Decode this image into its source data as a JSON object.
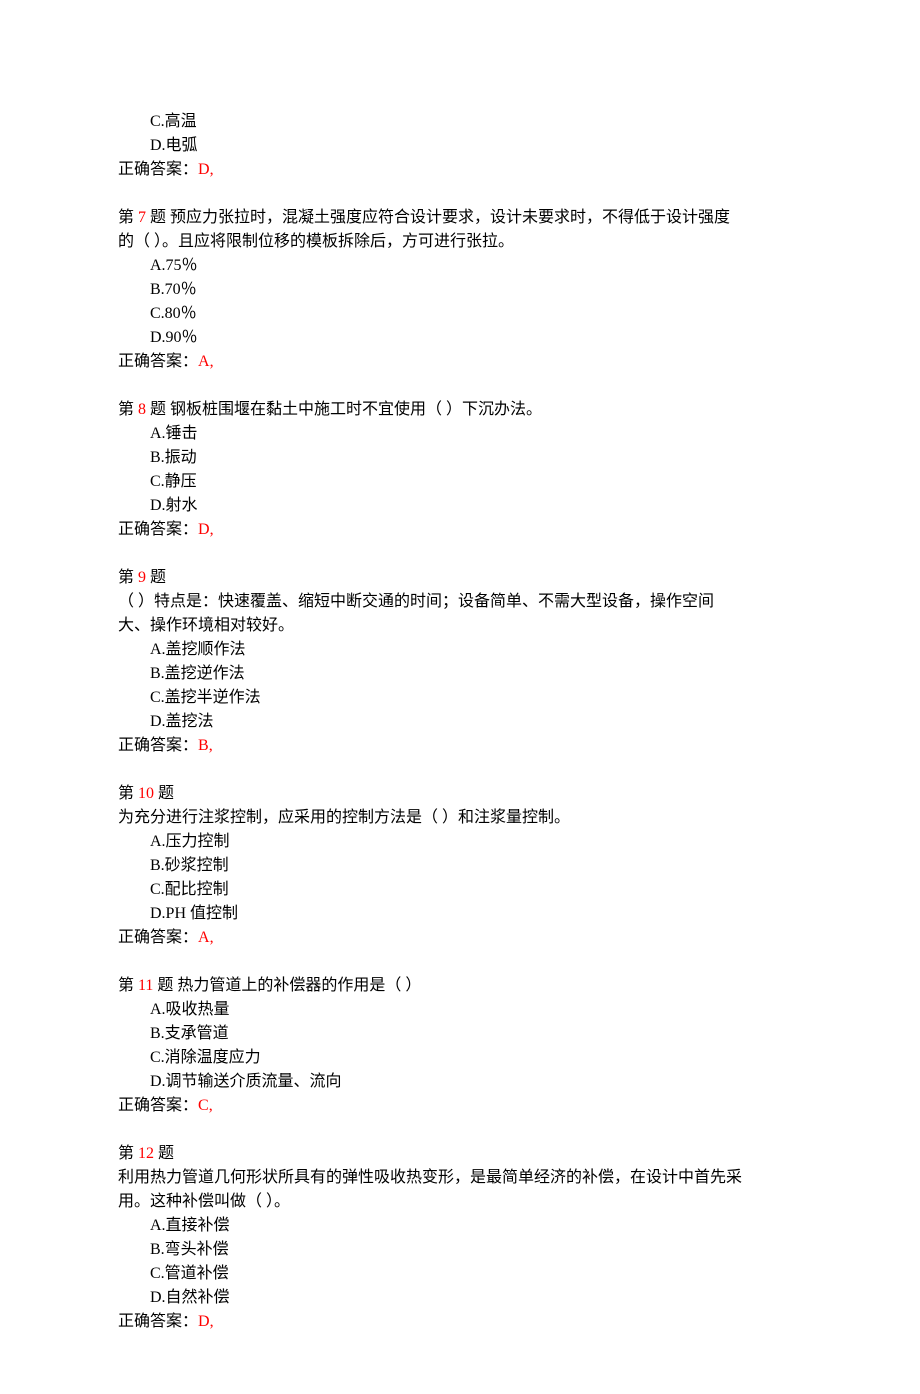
{
  "q6_remainder": {
    "options": [
      "C.高温",
      "D.电弧"
    ],
    "answer_label": "正确答案：",
    "answer_value": "D,"
  },
  "questions": [
    {
      "prefix": "第 ",
      "num": "7",
      "suffix": " 题  预应力张拉时，混凝土强度应符合设计要求，设计未要求时，不得低于设计强度",
      "stem_cont": [
        "的（  ）。且应将限制位移的模板拆除后，方可进行张拉。"
      ],
      "options": [
        "A.75％",
        "B.70％",
        "C.80％",
        "D.90％"
      ],
      "answer_label": "正确答案：",
      "answer_value": "A,"
    },
    {
      "prefix": "第 ",
      "num": "8",
      "suffix": " 题 钢板桩围堰在黏土中施工时不宜使用（  ）下沉办法。",
      "stem_cont": [],
      "options": [
        "A.锤击",
        "B.振动",
        "C.静压",
        "D.射水"
      ],
      "answer_label": "正确答案：",
      "answer_value": "D,"
    },
    {
      "prefix": "第 ",
      "num": "9",
      "suffix": " 题",
      "stem_cont": [
        "（  ）特点是：快速覆盖、缩短中断交通的时间；设备简单、不需大型设备，操作空间",
        "大、操作环境相对较好。"
      ],
      "options": [
        "A.盖挖顺作法",
        "B.盖挖逆作法",
        "C.盖挖半逆作法",
        "D.盖挖法"
      ],
      "answer_label": "正确答案：",
      "answer_value": "B,"
    },
    {
      "prefix": "第 ",
      "num": "10",
      "suffix": " 题",
      "stem_cont": [
        "为充分进行注浆控制，应采用的控制方法是（  ）和注浆量控制。"
      ],
      "options": [
        "A.压力控制",
        "B.砂浆控制",
        "C.配比控制",
        "D.PH 值控制"
      ],
      "answer_label": "正确答案：",
      "answer_value": "A,"
    },
    {
      "prefix": "第 ",
      "num": "11",
      "suffix": " 题  热力管道上的补偿器的作用是（  ）",
      "stem_cont": [],
      "options": [
        "A.吸收热量",
        "B.支承管道",
        "C.消除温度应力",
        "D.调节输送介质流量、流向"
      ],
      "answer_label": "正确答案：",
      "answer_value": "C,"
    },
    {
      "prefix": "第 ",
      "num": "12",
      "suffix": " 题",
      "stem_cont": [
        "利用热力管道几何形状所具有的弹性吸收热变形，是最简单经济的补偿，在设计中首先采",
        "用。这种补偿叫做（  ）。"
      ],
      "options": [
        "A.直接补偿",
        "B.弯头补偿",
        "C.管道补偿",
        "D.自然补偿"
      ],
      "answer_label": "正确答案：",
      "answer_value": "D,"
    }
  ]
}
